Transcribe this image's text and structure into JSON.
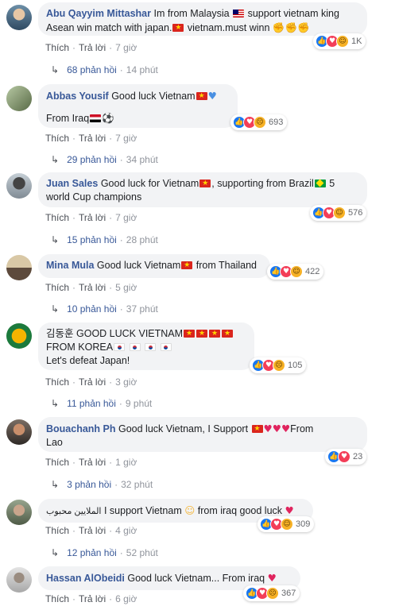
{
  "comments": [
    {
      "author": "Abu Qayyim Mittashar",
      "text_a": "Im from Malaysia",
      "text_b": "support vietnam king",
      "text_c": "Asean win match with japan.",
      "text_d": "vietnam.must winn",
      "reactions": [
        "like",
        "love",
        "haha"
      ],
      "reaction_count": "1K",
      "like_label": "Thích",
      "reply_label": "Trả lời",
      "time": "7 giờ",
      "replies_label": "68 phản hồi",
      "replies_time": "14 phút"
    },
    {
      "author": "Abbas Yousif",
      "text_a": "Good luck Vietnam",
      "text_b": "From Iraq",
      "reactions": [
        "like",
        "love",
        "sad"
      ],
      "reaction_count": "693",
      "like_label": "Thích",
      "reply_label": "Trả lời",
      "time": "7 giờ",
      "replies_label": "29 phản hồi",
      "replies_time": "34 phút"
    },
    {
      "author": "Juan Sales",
      "text_a": "Good luck for Vietnam",
      "text_b": ", supporting from Brazil",
      "text_c": "5",
      "text_d": "world Cup champions",
      "reactions": [
        "like",
        "love",
        "haha"
      ],
      "reaction_count": "576",
      "like_label": "Thích",
      "reply_label": "Trả lời",
      "time": "7 giờ",
      "replies_label": "15 phản hồi",
      "replies_time": "28 phút"
    },
    {
      "author": "Mina Mula",
      "text_a": "Good luck Vietnam",
      "text_b": "from Thailand",
      "reactions": [
        "like",
        "love",
        "haha"
      ],
      "reaction_count": "422",
      "like_label": "Thích",
      "reply_label": "Trả lời",
      "time": "5 giờ",
      "replies_label": "10 phản hồi",
      "replies_time": "37 phút"
    },
    {
      "author": "김동훈",
      "text_a": "GOOD LUCK VIETNAM",
      "text_b": "FROM KOREA",
      "text_c": "Let's defeat Japan!",
      "reactions": [
        "like",
        "love",
        "wow"
      ],
      "reaction_count": "105",
      "like_label": "Thích",
      "reply_label": "Trả lời",
      "time": "3 giờ",
      "replies_label": "11 phản hồi",
      "replies_time": "9 phút"
    },
    {
      "author": "Bouachanh Ph",
      "text_a": "Good luck Vietnam, I Support",
      "text_b": "From",
      "text_c": "Lao",
      "reactions": [
        "like",
        "love"
      ],
      "reaction_count": "23",
      "like_label": "Thích",
      "reply_label": "Trả lời",
      "time": "1 giờ",
      "replies_label": "3 phản hồi",
      "replies_time": "32 phút"
    },
    {
      "author": "الملايين محبوب",
      "text_a": "I support Vietnam",
      "text_b": "from iraq good luck",
      "reactions": [
        "like",
        "love",
        "haha"
      ],
      "reaction_count": "309",
      "like_label": "Thích",
      "reply_label": "Trả lời",
      "time": "4 giờ",
      "replies_label": "12 phản hồi",
      "replies_time": "52 phút"
    },
    {
      "author": "Hassan AlObeidi",
      "text_a": "Good luck Vietnam... From iraq",
      "reactions": [
        "like",
        "love",
        "sad"
      ],
      "reaction_count": "367",
      "like_label": "Thích",
      "reply_label": "Trả lời",
      "time": "6 giờ"
    }
  ]
}
